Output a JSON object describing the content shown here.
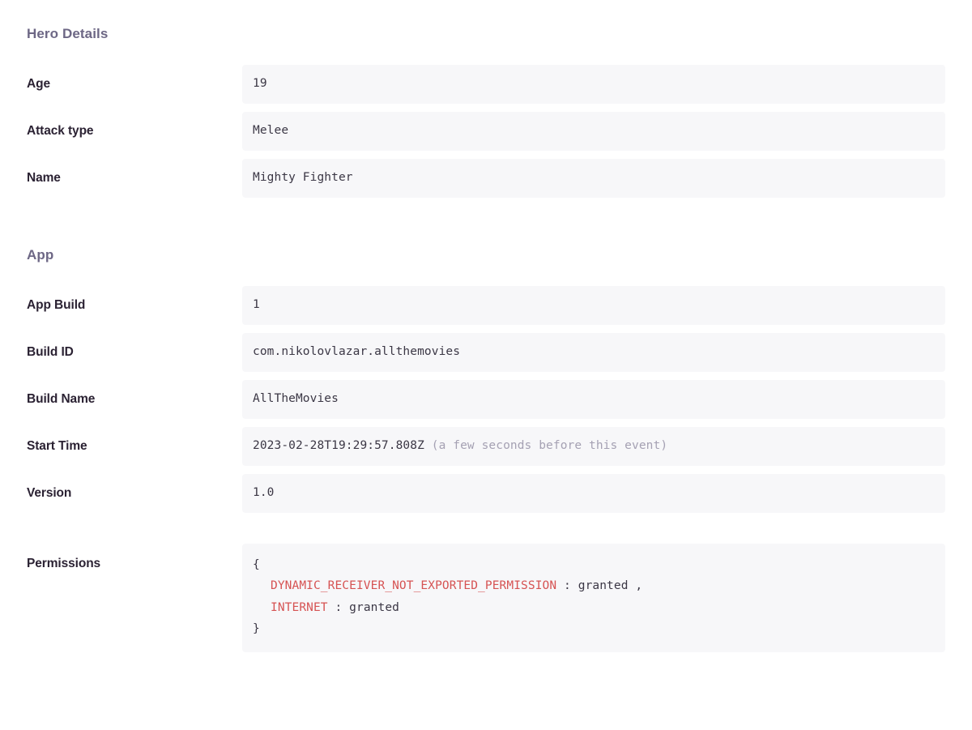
{
  "colors": {
    "section_header": "#6d6785",
    "label": "#2b2233",
    "value": "#3b3745",
    "value_bg": "#f7f7f9",
    "muted": "#a5a1b3",
    "code_key": "#d65353",
    "page_bg": "#ffffff"
  },
  "sections": [
    {
      "title": "Hero Details",
      "rows": [
        {
          "label": "Age",
          "value": "19"
        },
        {
          "label": "Attack type",
          "value": "Melee"
        },
        {
          "label": "Name",
          "value": "Mighty Fighter"
        }
      ]
    },
    {
      "title": "App",
      "rows": [
        {
          "label": "App Build",
          "value": "1"
        },
        {
          "label": "Build ID",
          "value": "com.nikolovlazar.allthemovies"
        },
        {
          "label": "Build Name",
          "value": "AllTheMovies"
        },
        {
          "label": "Start Time",
          "value": "2023-02-28T19:29:57.808Z",
          "annotation": "(a few seconds before this event)"
        },
        {
          "label": "Version",
          "value": "1.0"
        }
      ],
      "permissions": {
        "label": "Permissions",
        "open_brace": "{",
        "close_brace": "}",
        "entries": [
          {
            "key": "DYNAMIC_RECEIVER_NOT_EXPORTED_PERMISSION",
            "colon": ":",
            "value": "granted",
            "comma": ","
          },
          {
            "key": "INTERNET",
            "colon": ":",
            "value": "granted",
            "comma": ""
          }
        ]
      }
    }
  ]
}
